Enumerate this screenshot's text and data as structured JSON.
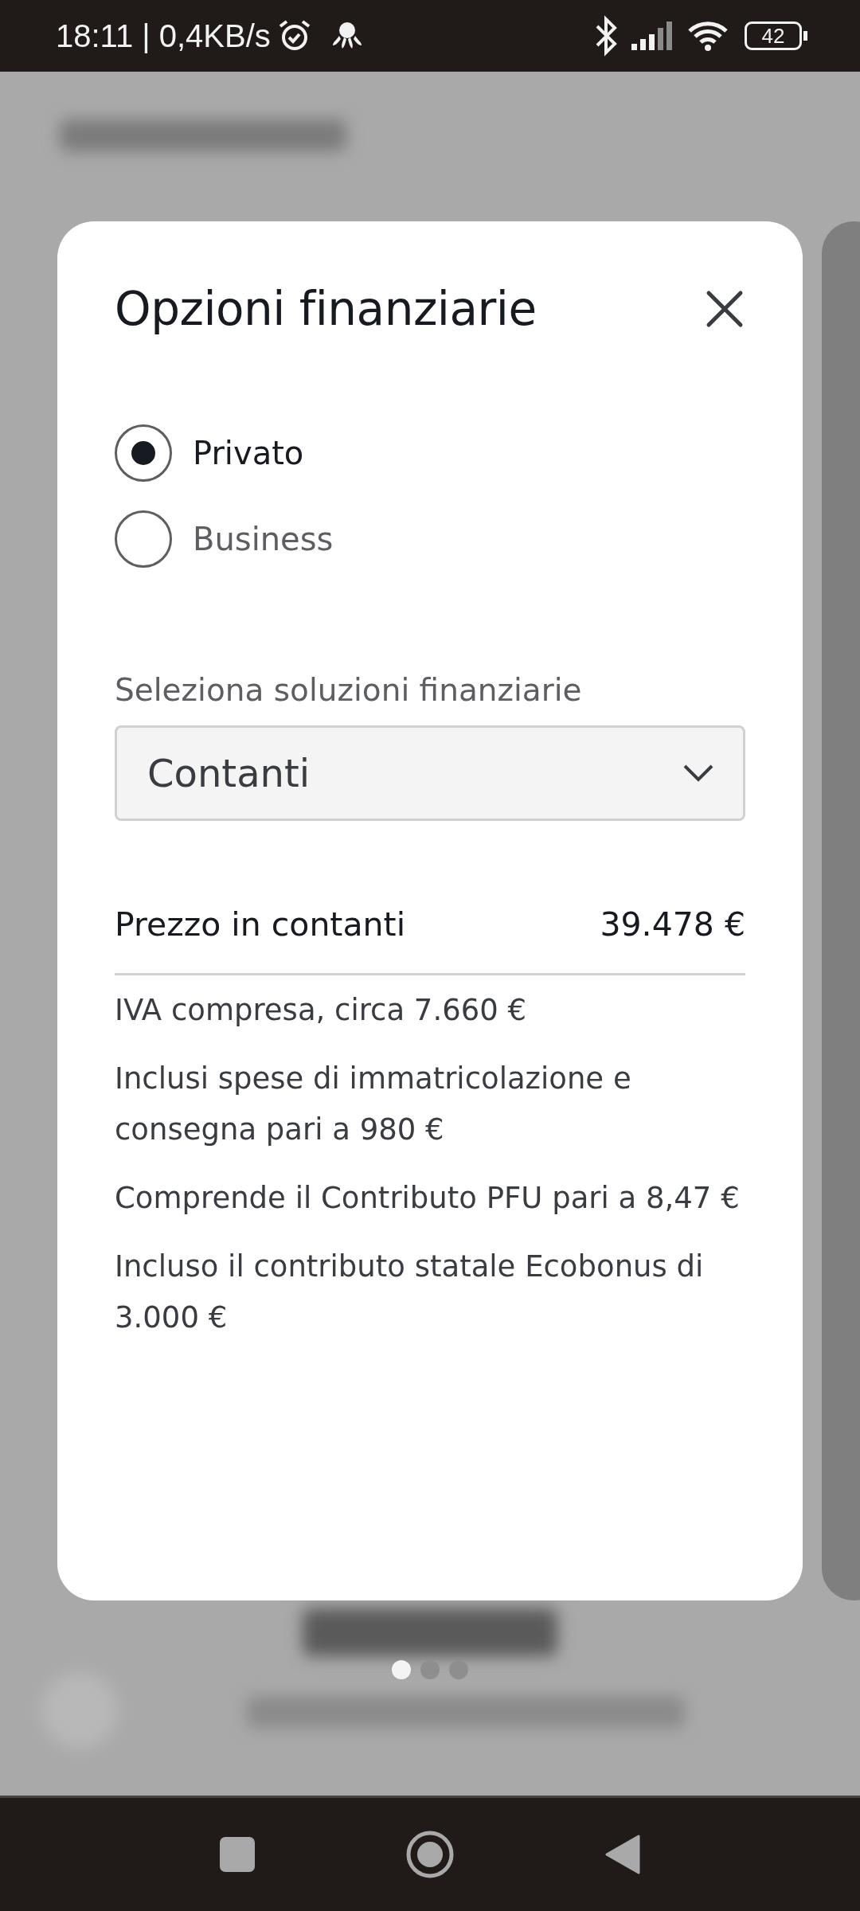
{
  "status_bar": {
    "time": "18:11 | 0,4KB/s",
    "battery": "42"
  },
  "dialog": {
    "title": "Opzioni finanziarie",
    "customer_types": [
      {
        "label": "Privato",
        "selected": true
      },
      {
        "label": "Business",
        "selected": false
      }
    ],
    "finance_label": "Seleziona soluzioni finanziarie",
    "finance_select": {
      "value": "Contanti"
    },
    "price": {
      "label": "Prezzo in contanti",
      "value": "39.478 €"
    },
    "notes": [
      "IVA compresa, circa 7.660 €",
      "Inclusi spese di immatricolazione e consegna pari a 980 €",
      "Comprende il Contributo PFU pari a 8,47 €",
      "Incluso il contributo statale Ecobonus di 3.000 €"
    ]
  },
  "pager": [
    {
      "selected": true
    },
    {
      "selected": false
    },
    {
      "selected": false
    }
  ]
}
